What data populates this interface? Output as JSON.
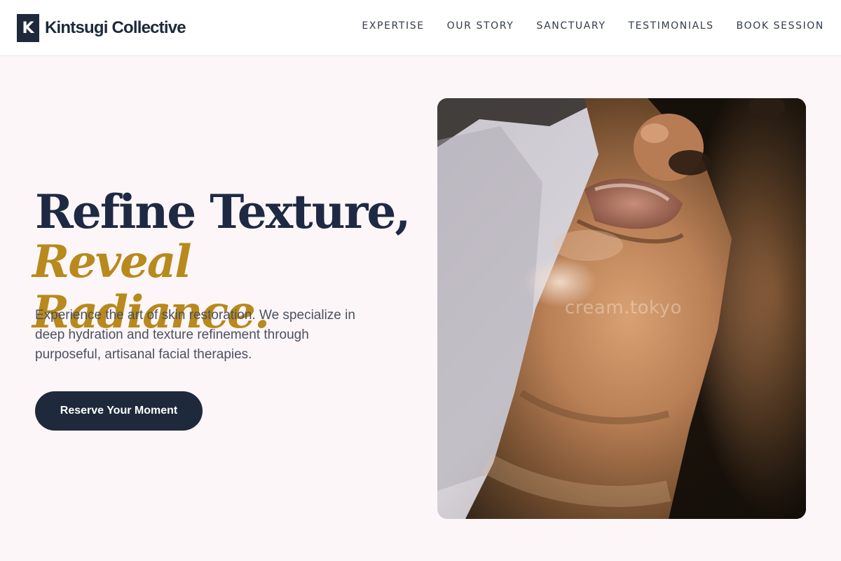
{
  "brand": {
    "mark": "K",
    "name": "Kintsugi Collective"
  },
  "nav": {
    "items": [
      {
        "label": "EXPERTISE"
      },
      {
        "label": "OUR STORY"
      },
      {
        "label": "SANCTUARY"
      },
      {
        "label": "TESTIMONIALS"
      },
      {
        "label": "BOOK SESSION"
      }
    ]
  },
  "hero": {
    "title_line1": "Refine Texture,",
    "title_line2": "Reveal Radiance.",
    "description": "Experience the art of skin restoration. We specialize in deep hydration and texture refinement through purposeful, artisanal facial therapies.",
    "cta_label": "Reserve Your Moment",
    "image_watermark": "cream.tokyo"
  },
  "colors": {
    "navy": "#1e293b",
    "gold": "#b8891c",
    "background": "#fdf6f8"
  }
}
